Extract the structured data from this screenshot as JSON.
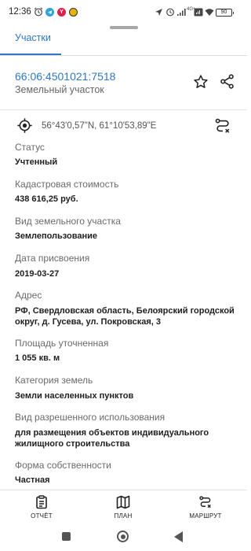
{
  "status_bar": {
    "time": "12:36",
    "signal_type": "4G+",
    "battery": "90",
    "app_badges": [
      {
        "icon": "telegram-icon",
        "color": "#2aa3df"
      },
      {
        "icon": "yandex-icon",
        "letter": "Y",
        "color": "#e0204a"
      },
      {
        "icon": "app-icon",
        "color": "#e8b400"
      }
    ]
  },
  "tabs": {
    "active_label": "Участки"
  },
  "parcel": {
    "cadastral_number": "66:06:4501021:7518",
    "subtitle": "Земельный участок",
    "coordinates": "56°43'0,57\"N, 61°10'53,89\"E"
  },
  "fields": [
    {
      "label": "Статус",
      "value": "Учтенный"
    },
    {
      "label": "Кадастровая стоимость",
      "value": "438 616,25 руб."
    },
    {
      "label": "Вид земельного участка",
      "value": "Землепользование"
    },
    {
      "label": "Дата присвоения",
      "value": "2019-03-27"
    },
    {
      "label": "Адрес",
      "value": "РФ, Свердловская область, Белоярский городской округ, д. Гусева, ул. Покровская, 3"
    },
    {
      "label": "Площадь уточненная",
      "value": "1 055 кв. м"
    },
    {
      "label": "Категория земель",
      "value": "Земли населенных пунктов"
    },
    {
      "label": "Вид разрешенного использования",
      "value": "для размещения объектов индивидуального жилищного строительства"
    },
    {
      "label": "Форма собственности",
      "value": "Частная"
    }
  ],
  "bottom_nav": {
    "report": "ОТЧЁТ",
    "plan": "ПЛАН",
    "route": "МАРШРУТ"
  },
  "colors": {
    "accent": "#2f78c4",
    "label": "#6a6a6a",
    "value": "#202020"
  }
}
